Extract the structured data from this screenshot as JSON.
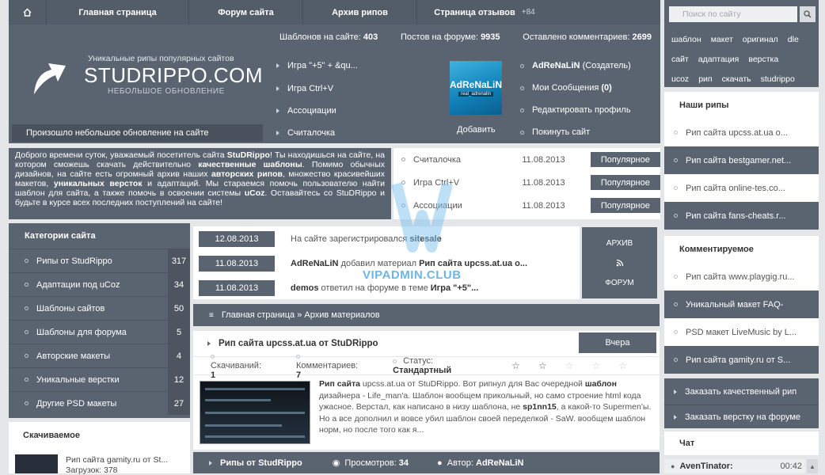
{
  "topnav": {
    "items": [
      "Главная страница",
      "Форум сайта",
      "Архив рипов",
      "Страница отзывов"
    ],
    "reviews_count": "+84"
  },
  "stats": {
    "templates_label": "Шаблонов на сайте:",
    "templates": "403",
    "posts_label": "Постов на форуме:",
    "posts": "9935",
    "comments_label": "Оставлено комментариев:",
    "comments": "2699"
  },
  "logo": {
    "tagline": "Уникальные рипы популярных сайтов",
    "name": "STUDRIPPO.COM",
    "subtitle": "НЕБОЛЬШОЕ ОБНОВЛЕНИЕ"
  },
  "header_notice": "Произошло небольшое обновление на сайте",
  "header_links": [
    "Игра \"+5\" + &qu...",
    "Игра Ctrl+V",
    "Ассоциации",
    "Считалочка"
  ],
  "profile": {
    "avatar_text": "AdReNaLiN",
    "avatar_small": "real_adrenalin",
    "add_label": "Добавить",
    "name": "AdReNaLiN",
    "role": "(Создатель)",
    "messages_label": "Мои Сообщения",
    "messages_count": "(0)",
    "edit_label": "Редактировать профиль",
    "logout_label": "Покинуть сайт"
  },
  "welcome": {
    "p1": "Доброго времени суток, уважаемый посетитель сайта ",
    "site": "StuDRippo",
    "p2": "! Ты находишься на сайте, на котором сможешь скачать действительно ",
    "q": "качественные шаблоны",
    "p3": ". Помимо обычных дизайнов, на сайте есть огромный архив наших ",
    "rips": "авторских рипов",
    "p4": ", множество красивейших макетов, ",
    "layouts": "уникальных версток",
    "p5": " и адаптаций. Мы стараемся помочь пользователю найти шаблон для сайта, а также помочь в освоении системы ",
    "ucoz": "uCoz",
    "p6": ". Оставайтесь со StuDRippo и будьте в курсе всех последних поступлений на сайте!"
  },
  "popular": [
    {
      "title": "Считалочка",
      "date": "11.08.2013",
      "btn": "Популярное"
    },
    {
      "title": "Игра Ctrl+V",
      "date": "11.08.2013",
      "btn": "Популярное"
    },
    {
      "title": "Ассоциации",
      "date": "11.08.2013",
      "btn": "Популярное"
    }
  ],
  "categories": {
    "title": "Категории сайта",
    "items": [
      {
        "label": "Рипы от StudRippo",
        "count": "317"
      },
      {
        "label": "Адаптации под uCoz",
        "count": "34"
      },
      {
        "label": "Шаблоны сайтов",
        "count": "50"
      },
      {
        "label": "Шаблоны для форума",
        "count": "5"
      },
      {
        "label": "Авторские макеты",
        "count": "4"
      },
      {
        "label": "Уникальные верстки",
        "count": "12"
      },
      {
        "label": "Другие PSD макеты",
        "count": "27"
      }
    ]
  },
  "downloaded": {
    "title": "Скачиваемое",
    "item_title": "Рип сайта gamity.ru от St...",
    "item_sub": "Загрузок: 378"
  },
  "activity": [
    {
      "date": "12.08.2013",
      "a": "На сайте зарегистрировался ",
      "b": "sitesale",
      "c": ""
    },
    {
      "date": "11.08.2013",
      "a": "",
      "b": "AdReNaLiN",
      "c": " добавил материал ",
      "d": "Рип сайта upcss.at.ua о..."
    },
    {
      "date": "11.08.2013",
      "a": "",
      "b": "demos",
      "c": " ответил на форуме в теме ",
      "d": "Игра \"+5\"..."
    }
  ],
  "archive": {
    "top": "АРХИВ",
    "bottom": "ФОРУМ"
  },
  "watermark": "VIPADMIN.CLUB",
  "breadcrumb": "Главная страница » Архив материалов",
  "post": {
    "title": "Рип сайта upcss.at.ua от StuDRippo",
    "day": "Вчера",
    "downloads_label": "Скачиваний:",
    "downloads": "1",
    "comments_label": "Комментариев:",
    "comments": "7",
    "status_label": "Статус:",
    "status": "Стандартный",
    "rating_stars": 2,
    "body_b1": "Рип сайта",
    "body_1": " upcss.at.ua от StuDRippo. Вот рипнул для Вас очередной ",
    "body_b2": "шаблон",
    "body_2": " дизайнера - Life_man'a. Шаблон вообщем прикольный, но само строение html кода ужасное. Верстал, как написано в низу шаблона, не ",
    "body_b3": "sp1nn15",
    "body_3": ", а какой-то Supermen'ы. Но а все дополнил и вовсе убил шаблон своей переделкой - SaW. вообщем шаблон норм, но после того как я..."
  },
  "post_footer": {
    "category": "Рипы от StudRippo",
    "views_label": "Просмотров:",
    "views": "34",
    "author_label": "Автор:",
    "author": "AdReNaLiN"
  },
  "search": {
    "placeholder": "Поиск по сайту",
    "tags": [
      "шаблон",
      "макет",
      "оригинал",
      "dle",
      "сайт",
      "адаптация",
      "верстка",
      "ucoz",
      "рип",
      "скачать",
      "studrippo"
    ]
  },
  "our_rips": {
    "title": "Наши рипы",
    "items": [
      "Рип сайта upcss.at.ua о...",
      "Рип сайта bestgamer.net...",
      "Рип сайта online-tes.co...",
      "Рип сайта fans-cheats.r..."
    ]
  },
  "commented": {
    "title": "Комментируемое",
    "items": [
      "Рип сайта www.playgig.ru...",
      "Уникальный макет FAQ-",
      "PSD макет LiveMusic by L...",
      "Рип сайта gamity.ru от S..."
    ]
  },
  "order": [
    "Заказать качественный рип",
    "Заказать верстку на форуме"
  ],
  "chat": {
    "title": "Чат",
    "user": "AvenTinator:",
    "time": "00:42"
  }
}
